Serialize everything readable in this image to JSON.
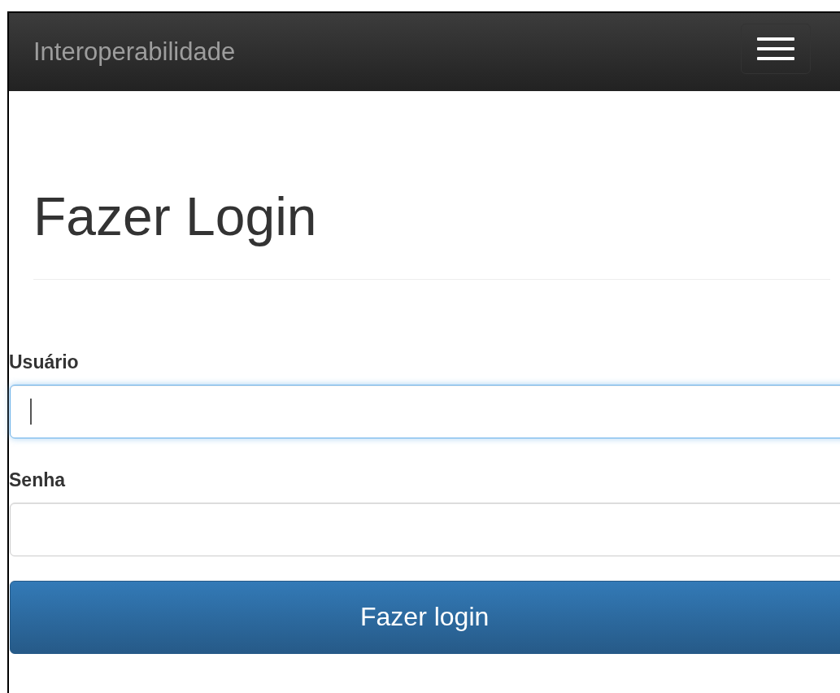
{
  "navbar": {
    "brand": "Interoperabilidade"
  },
  "heading": "Fazer Login",
  "fields": [
    {
      "label": "Usuário",
      "focused": true
    },
    {
      "label": "Senha",
      "focused": false
    }
  ],
  "submit": "Fazer login"
}
